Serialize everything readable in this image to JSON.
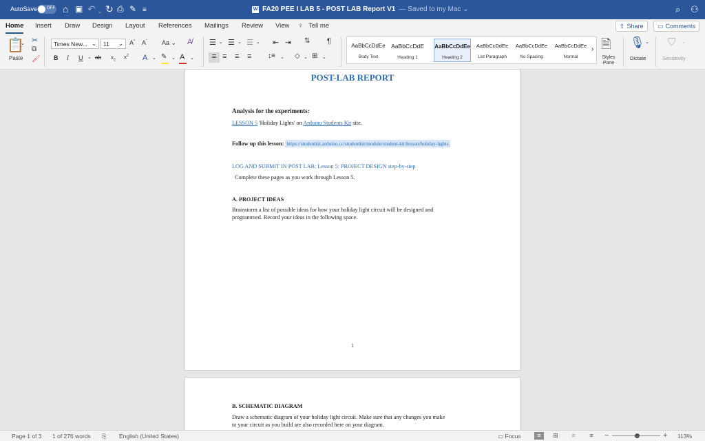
{
  "titlebar": {
    "autosave_label": "AutoSave",
    "autosave_state": "OFF",
    "doc_title": "FA20 PEE I LAB 5 - POST LAB Report V1",
    "saved_status": "— Saved to my Mac ⌄",
    "word_icon": "W"
  },
  "tabs": [
    "Home",
    "Insert",
    "Draw",
    "Design",
    "Layout",
    "References",
    "Mailings",
    "Review",
    "View",
    "Tell me"
  ],
  "share_label": "Share",
  "comments_label": "Comments",
  "ribbon": {
    "paste_label": "Paste",
    "font_name": "Times New...",
    "font_size": "11",
    "change_case": "Aa",
    "styles": [
      {
        "sample": "AaBbCcDdEe",
        "name": "Body Text"
      },
      {
        "sample": "AaBbCcDdE",
        "name": "Heading 1"
      },
      {
        "sample": "AaBbCcDdEe",
        "name": "Heading 2"
      },
      {
        "sample": "AaBbCcDdEe",
        "name": "List Paragraph"
      },
      {
        "sample": "AaBbCcDdEe",
        "name": "No Spacing"
      },
      {
        "sample": "AaBbCcDdEe",
        "name": "Normal"
      }
    ],
    "styles_pane_label": "Styles Pane",
    "dictate_label": "Dictate",
    "sensitivity_label": "Sensitivity"
  },
  "document": {
    "title": "POST-LAB REPORT",
    "analysis_heading": "Analysis for the experiments:",
    "lesson_link": "LESSON 5",
    "lesson_text": " 'Holiday Lights' on ",
    "site_link": "Arduino Students Kit",
    "site_suffix": " site.",
    "follow_label": "Follow up this lesson: ",
    "follow_url": "https://studentkit.arduino.cc/studentkit/module/student-kit/lesson/holiday-lights",
    "log_heading": "LOG AND SUBMIT IN POST LAB: Lesson 5: PROJECT DESIGN step-by-step",
    "complete_text": "Complete these pages as you work through Lesson 5.",
    "section_a": "A. PROJECT IDEAS",
    "section_a_line1": "Brainstorm a list of possible ideas for how your holiday light circuit will be designed and",
    "section_a_line2": "programmed. Record your ideas in the following space.",
    "page_number": "1",
    "section_b": "B. SCHEMATIC DIAGRAM",
    "section_b_line1": "Draw a schematic diagram of your holiday light circuit. Make sure that any changes you make",
    "section_b_line2": "to your circuit as you build are also recorded here on your diagram."
  },
  "status": {
    "page": "Page 1 of 3",
    "words": "1 of 276 words",
    "language": "English (United States)",
    "focus": "Focus",
    "zoom": "113%"
  },
  "colors": {
    "titlebar": "#2b579a",
    "heading_blue": "#2f6fb3"
  }
}
